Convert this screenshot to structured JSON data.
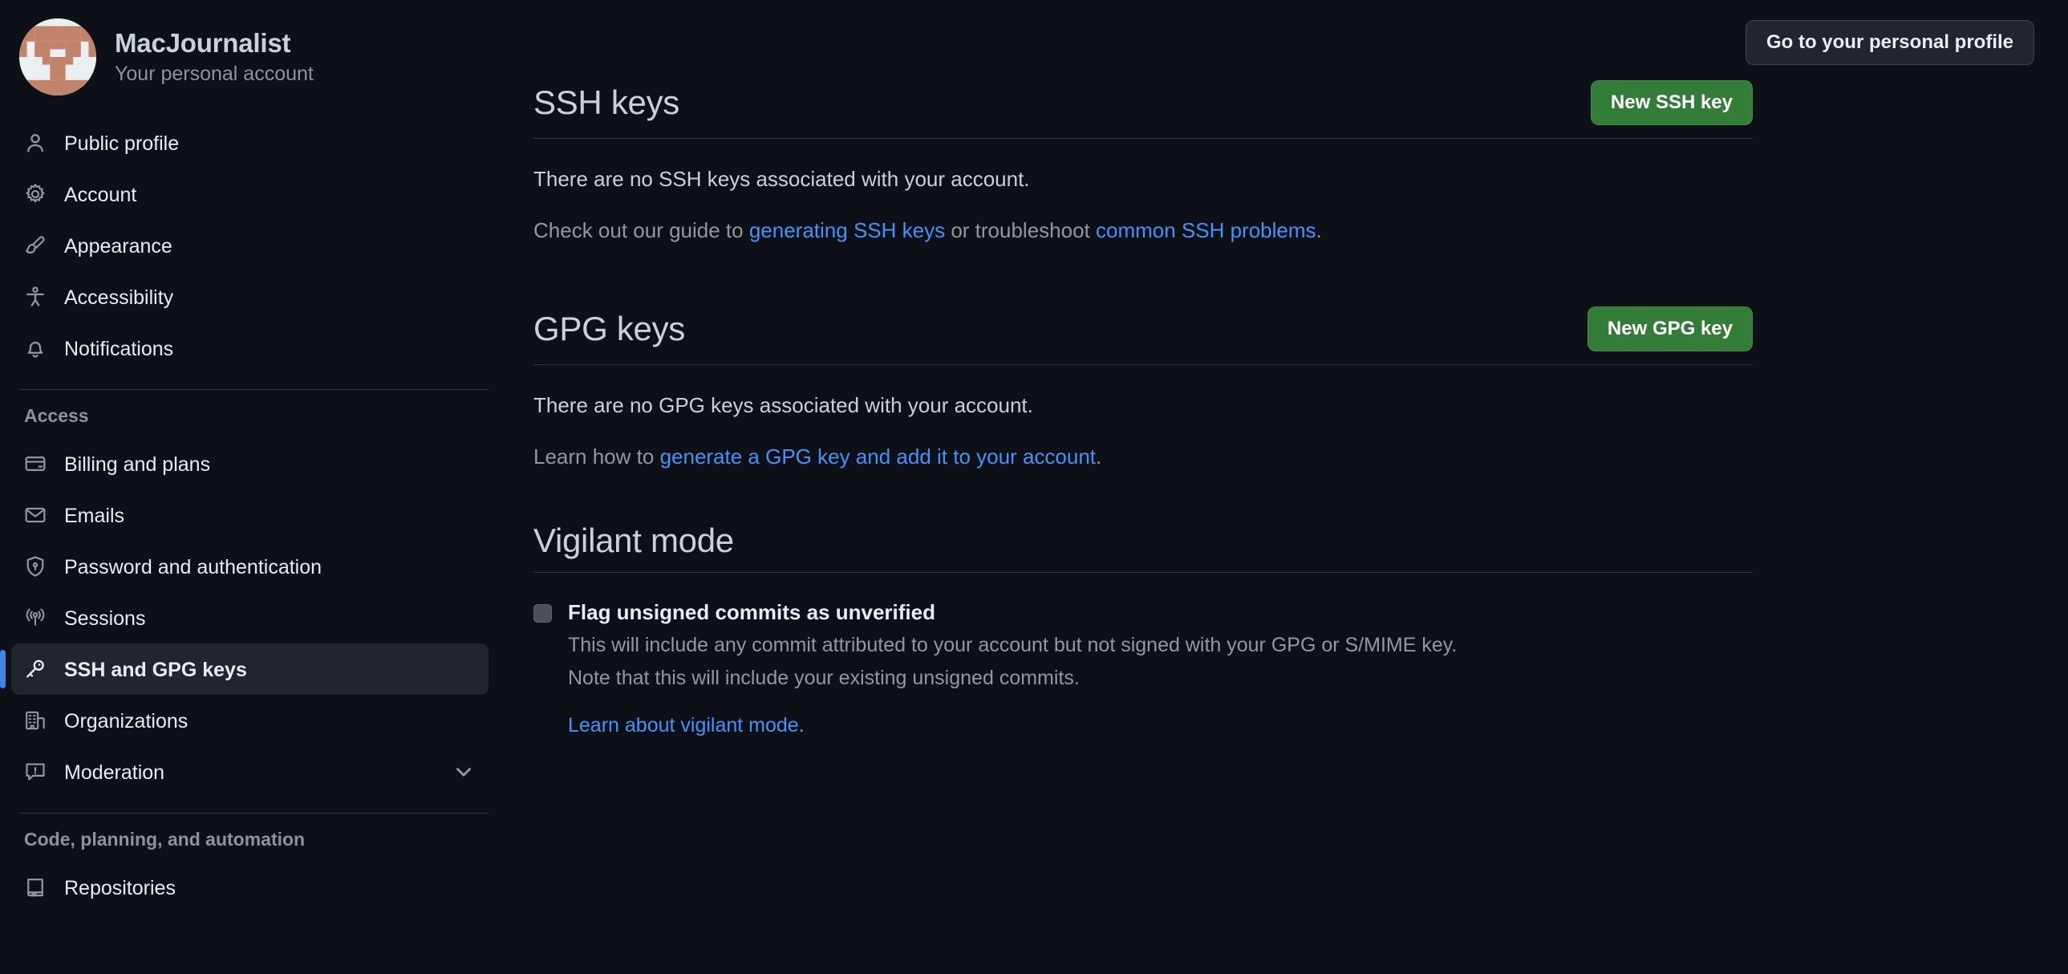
{
  "account": {
    "name": "MacJournalist",
    "subtitle": "Your personal account",
    "avatar_colors": {
      "base": "#eceff1",
      "blocks": "#c2836b"
    }
  },
  "topbar": {
    "profile_button": "Go to your personal profile"
  },
  "sidebar": {
    "primary": [
      {
        "label": "Public profile",
        "icon": "person-icon",
        "active": false
      },
      {
        "label": "Account",
        "icon": "gear-icon",
        "active": false
      },
      {
        "label": "Appearance",
        "icon": "paintbrush-icon",
        "active": false
      },
      {
        "label": "Accessibility",
        "icon": "accessibility-icon",
        "active": false
      },
      {
        "label": "Notifications",
        "icon": "bell-icon",
        "active": false
      }
    ],
    "access_group_label": "Access",
    "access": [
      {
        "label": "Billing and plans",
        "icon": "credit-card-icon",
        "active": false
      },
      {
        "label": "Emails",
        "icon": "mail-icon",
        "active": false
      },
      {
        "label": "Password and authentication",
        "icon": "shield-lock-icon",
        "active": false
      },
      {
        "label": "Sessions",
        "icon": "broadcast-icon",
        "active": false
      },
      {
        "label": "SSH and GPG keys",
        "icon": "key-icon",
        "active": true
      },
      {
        "label": "Organizations",
        "icon": "organization-icon",
        "active": false
      },
      {
        "label": "Moderation",
        "icon": "report-icon",
        "active": false,
        "chevron": "chevron-down-icon"
      }
    ],
    "code_group_label": "Code, planning, and automation",
    "code": [
      {
        "label": "Repositories",
        "icon": "repo-icon",
        "active": false
      }
    ]
  },
  "main": {
    "ssh": {
      "title": "SSH keys",
      "button": "New SSH key",
      "empty_text": "There are no SSH keys associated with your account.",
      "help_prefix": "Check out our guide to ",
      "help_link1": "generating SSH keys",
      "help_middle": " or troubleshoot ",
      "help_link2": "common SSH problems",
      "help_suffix": "."
    },
    "gpg": {
      "title": "GPG keys",
      "button": "New GPG key",
      "empty_text": "There are no GPG keys associated with your account.",
      "help_prefix": "Learn how to ",
      "help_link1": "generate a GPG key and add it to your account",
      "help_suffix": "."
    },
    "vigilant": {
      "title": "Vigilant mode",
      "checkbox_label": "Flag unsigned commits as unverified",
      "desc_line1": "This will include any commit attributed to your account but not signed with your GPG or S/MIME key.",
      "desc_line2": "Note that this will include your existing unsigned commits.",
      "learn_link": "Learn about vigilant mode",
      "learn_suffix": ".",
      "checked": false
    }
  },
  "colors": {
    "background": "#0d1117",
    "accent_green": "#347d39",
    "link_blue": "#4493f8",
    "active_indicator": "#4184e4",
    "border": "#30363d"
  }
}
